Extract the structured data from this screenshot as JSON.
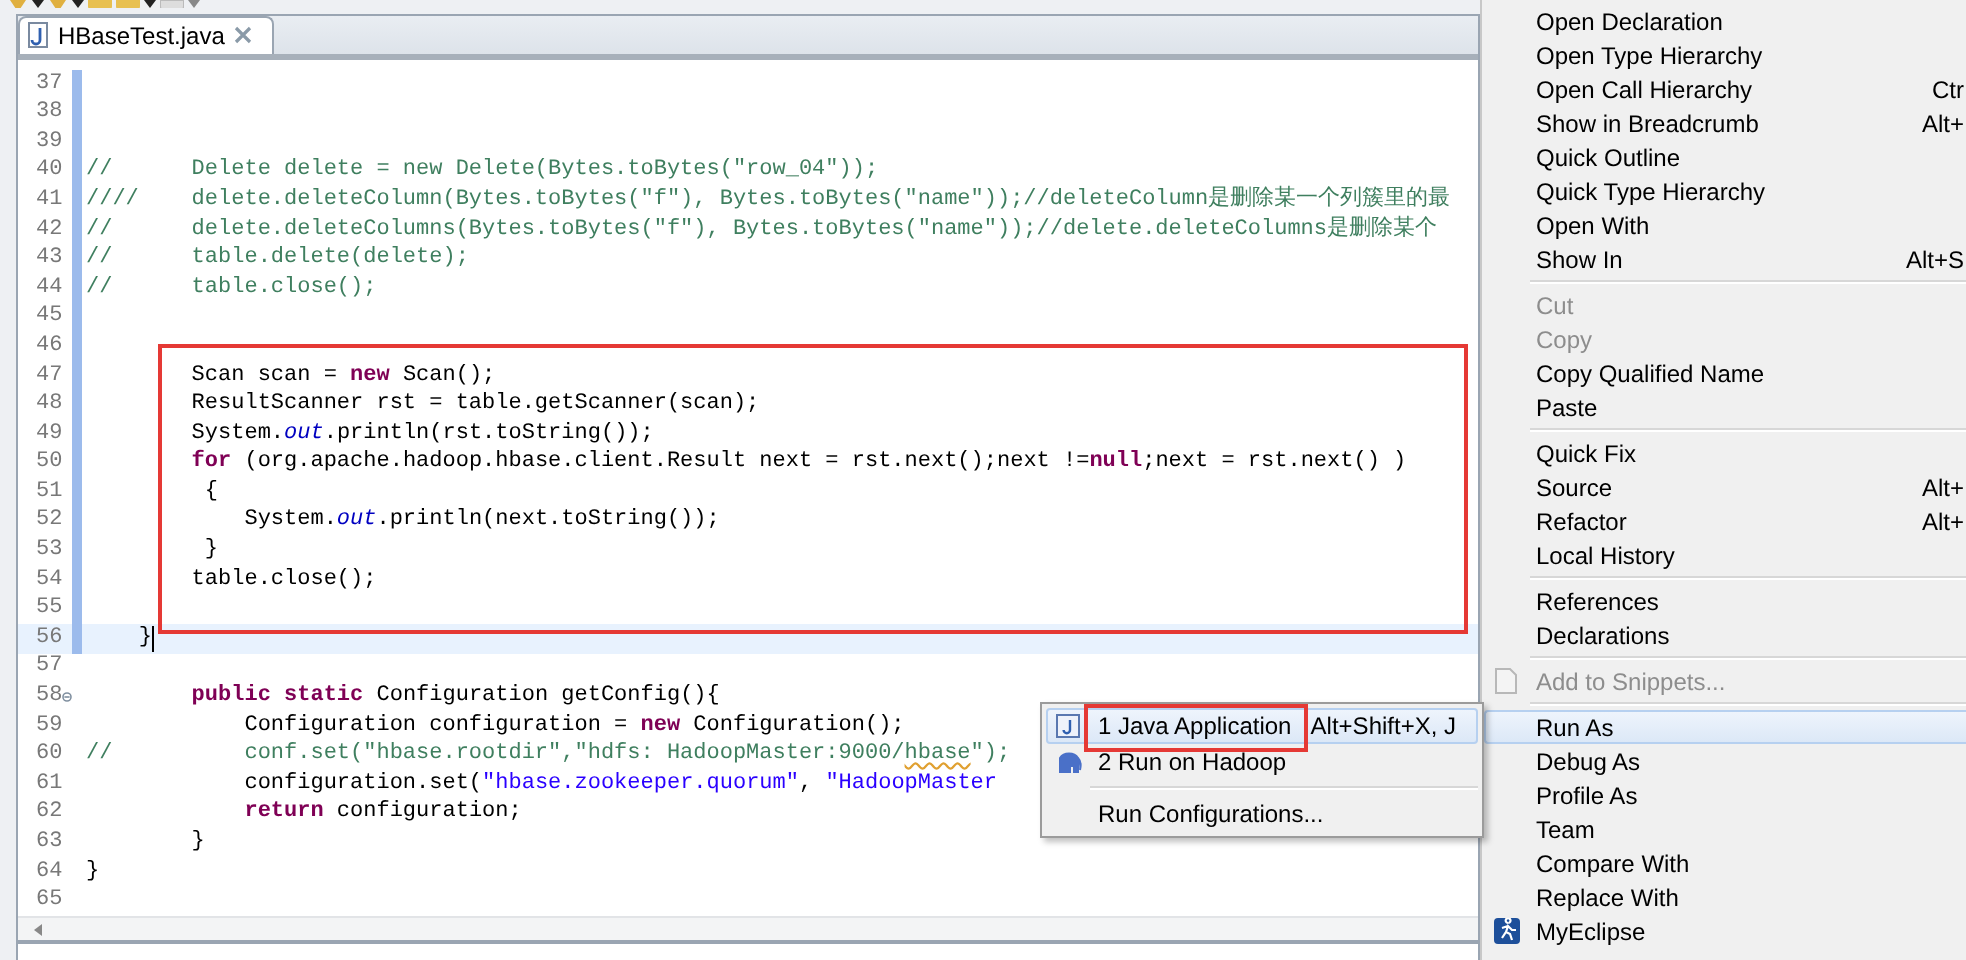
{
  "editor": {
    "tab": {
      "label": "HBaseTest.java",
      "selected": true
    },
    "lines": [
      {
        "number": "37",
        "marked": true,
        "current": false,
        "fold": false
      },
      {
        "number": "38",
        "marked": true,
        "current": false,
        "fold": false
      },
      {
        "number": "39",
        "marked": true,
        "current": false,
        "fold": false
      },
      {
        "number": "40",
        "marked": true,
        "current": false,
        "fold": false,
        "segments": [
          {
            "text": "//      Delete delete = new Delete(Bytes.toBytes(\"row_04\"));",
            "kind": "comment"
          }
        ]
      },
      {
        "number": "41",
        "marked": true,
        "current": false,
        "fold": false,
        "segments": [
          {
            "text": "////    delete.deleteColumn(Bytes.toBytes(\"f\"), Bytes.toBytes(\"name\"));//deleteColumn是删除某一个列簇里的最",
            "kind": "comment"
          }
        ]
      },
      {
        "number": "42",
        "marked": true,
        "current": false,
        "fold": false,
        "segments": [
          {
            "text": "//      delete.deleteColumns(Bytes.toBytes(\"f\"), Bytes.toBytes(\"name\"));//delete.deleteColumns是删除某个",
            "kind": "comment"
          }
        ]
      },
      {
        "number": "43",
        "marked": true,
        "current": false,
        "fold": false,
        "segments": [
          {
            "text": "//      table.delete(delete);",
            "kind": "comment"
          }
        ]
      },
      {
        "number": "44",
        "marked": true,
        "current": false,
        "fold": false,
        "segments": [
          {
            "text": "//      table.close();",
            "kind": "comment"
          }
        ]
      },
      {
        "number": "45",
        "marked": true,
        "current": false,
        "fold": false
      },
      {
        "number": "46",
        "marked": true,
        "current": false,
        "fold": false
      },
      {
        "number": "47",
        "marked": true,
        "current": false,
        "fold": false,
        "segments": [
          {
            "text": "        Scan scan = ",
            "kind": "plain"
          },
          {
            "text": "new",
            "kind": "keyword"
          },
          {
            "text": " Scan();",
            "kind": "plain"
          }
        ]
      },
      {
        "number": "48",
        "marked": true,
        "current": false,
        "fold": false,
        "segments": [
          {
            "text": "        ResultScanner rst = table.getScanner(scan);",
            "kind": "plain"
          }
        ]
      },
      {
        "number": "49",
        "marked": true,
        "current": false,
        "fold": false,
        "segments": [
          {
            "text": "        System.",
            "kind": "plain"
          },
          {
            "text": "out",
            "kind": "field"
          },
          {
            "text": ".println(rst.toString());",
            "kind": "plain"
          }
        ]
      },
      {
        "number": "50",
        "marked": true,
        "current": false,
        "fold": false,
        "segments": [
          {
            "text": "        for",
            "kind": "keyword"
          },
          {
            "text": " (org.apache.hadoop.hbase.client.Result next = rst.next();next !=",
            "kind": "plain"
          },
          {
            "text": "null",
            "kind": "keyword"
          },
          {
            "text": ";next = rst.next() )",
            "kind": "plain"
          }
        ]
      },
      {
        "number": "51",
        "marked": true,
        "current": false,
        "fold": false,
        "segments": [
          {
            "text": "         {",
            "kind": "plain"
          }
        ]
      },
      {
        "number": "52",
        "marked": true,
        "current": false,
        "fold": false,
        "segments": [
          {
            "text": "            System.",
            "kind": "plain"
          },
          {
            "text": "out",
            "kind": "field"
          },
          {
            "text": ".println(next.toString());",
            "kind": "plain"
          }
        ]
      },
      {
        "number": "53",
        "marked": true,
        "current": false,
        "fold": false,
        "segments": [
          {
            "text": "         }",
            "kind": "plain"
          }
        ]
      },
      {
        "number": "54",
        "marked": true,
        "current": false,
        "fold": false,
        "segments": [
          {
            "text": "        table.close();",
            "kind": "plain"
          }
        ]
      },
      {
        "number": "55",
        "marked": true,
        "current": false,
        "fold": false
      },
      {
        "number": "56",
        "marked": true,
        "current": true,
        "fold": false,
        "segments": [
          {
            "text": "    }",
            "kind": "plain"
          }
        ]
      },
      {
        "number": "57",
        "marked": false,
        "current": false,
        "fold": false
      },
      {
        "number": "58",
        "marked": false,
        "current": false,
        "fold": true,
        "segments": [
          {
            "text": "        public",
            "kind": "keyword"
          },
          {
            "text": " static",
            "kind": "keyword"
          },
          {
            "text": " Configuration getConfig(){",
            "kind": "plain"
          }
        ]
      },
      {
        "number": "59",
        "marked": false,
        "current": false,
        "fold": false,
        "segments": [
          {
            "text": "            Configuration configuration = ",
            "kind": "plain"
          },
          {
            "text": "new",
            "kind": "keyword"
          },
          {
            "text": " Configuration();",
            "kind": "plain"
          }
        ]
      },
      {
        "number": "60",
        "marked": false,
        "current": false,
        "fold": false,
        "segments": [
          {
            "text": "//          conf.set(\"hbase.rootdir\",\"hdfs: HadoopMaster:9000/",
            "kind": "comment"
          },
          {
            "text": "hbase",
            "kind": "misspelled"
          },
          {
            "text": "\");",
            "kind": "comment"
          }
        ]
      },
      {
        "number": "61",
        "marked": false,
        "current": false,
        "fold": false,
        "segments": [
          {
            "text": "            configuration.set(",
            "kind": "plain"
          },
          {
            "text": "\"hbase.zookeeper.quorum\"",
            "kind": "string"
          },
          {
            "text": ", ",
            "kind": "plain"
          },
          {
            "text": "\"HadoopMaster",
            "kind": "string"
          }
        ]
      },
      {
        "number": "62",
        "marked": false,
        "current": false,
        "fold": false,
        "segments": [
          {
            "text": "            return",
            "kind": "keyword"
          },
          {
            "text": " configuration;",
            "kind": "plain"
          }
        ]
      },
      {
        "number": "63",
        "marked": false,
        "current": false,
        "fold": false,
        "segments": [
          {
            "text": "        }",
            "kind": "plain"
          }
        ]
      },
      {
        "number": "64",
        "marked": false,
        "current": false,
        "fold": false,
        "segments": [
          {
            "text": "}",
            "kind": "plain"
          }
        ]
      },
      {
        "number": "65",
        "marked": false,
        "current": false,
        "fold": false
      }
    ]
  },
  "submenu": {
    "groups": [
      {
        "items": [
          {
            "label": "1 Java Application",
            "shortcut": "Alt+Shift+X, J",
            "kind": "java",
            "selected": true,
            "outlined": true
          },
          {
            "label": "2 Run on Hadoop",
            "kind": "elephant",
            "selected": false,
            "outlined": false
          }
        ]
      },
      {
        "items": [
          {
            "label": "Run Configurations...",
            "kind": "plain",
            "selected": false,
            "outlined": false
          }
        ]
      }
    ]
  },
  "context_menu": {
    "groups": [
      {
        "items": [
          {
            "label": "Open Declaration",
            "kind": "plain",
            "disabled": false,
            "selected": false
          },
          {
            "label": "Open Type Hierarchy",
            "kind": "plain",
            "disabled": false,
            "selected": false
          },
          {
            "label": "Open Call Hierarchy",
            "shortcut": "Ctr",
            "kind": "plain",
            "disabled": false,
            "selected": false
          },
          {
            "label": "Show in Breadcrumb",
            "shortcut": "Alt+",
            "kind": "plain",
            "disabled": false,
            "selected": false
          },
          {
            "label": "Quick Outline",
            "kind": "plain",
            "disabled": false,
            "selected": false
          },
          {
            "label": "Quick Type Hierarchy",
            "kind": "plain",
            "disabled": false,
            "selected": false
          },
          {
            "label": "Open With",
            "kind": "plain",
            "disabled": false,
            "selected": false
          },
          {
            "label": "Show In",
            "shortcut": "Alt+S",
            "kind": "plain",
            "disabled": false,
            "selected": false
          }
        ]
      },
      {
        "items": [
          {
            "label": "Cut",
            "kind": "plain",
            "disabled": true,
            "selected": false
          },
          {
            "label": "Copy",
            "kind": "plain",
            "disabled": true,
            "selected": false
          },
          {
            "label": "Copy Qualified Name",
            "kind": "plain",
            "disabled": false,
            "selected": false
          },
          {
            "label": "Paste",
            "kind": "plain",
            "disabled": false,
            "selected": false
          }
        ]
      },
      {
        "items": [
          {
            "label": "Quick Fix",
            "kind": "plain",
            "disabled": false,
            "selected": false
          },
          {
            "label": "Source",
            "shortcut": "Alt+",
            "kind": "plain",
            "disabled": false,
            "selected": false
          },
          {
            "label": "Refactor",
            "shortcut": "Alt+",
            "kind": "plain",
            "disabled": false,
            "selected": false
          },
          {
            "label": "Local History",
            "kind": "plain",
            "disabled": false,
            "selected": false
          }
        ]
      },
      {
        "items": [
          {
            "label": "References",
            "kind": "plain",
            "disabled": false,
            "selected": false
          },
          {
            "label": "Declarations",
            "kind": "plain",
            "disabled": false,
            "selected": false
          }
        ]
      },
      {
        "items": [
          {
            "label": "Add to Snippets...",
            "kind": "snippet",
            "disabled": true,
            "selected": false
          }
        ]
      },
      {
        "items": [
          {
            "label": "Run As",
            "kind": "plain",
            "disabled": false,
            "selected": true
          },
          {
            "label": "Debug As",
            "kind": "plain",
            "disabled": false,
            "selected": false
          },
          {
            "label": "Profile As",
            "kind": "plain",
            "disabled": false,
            "selected": false
          },
          {
            "label": "Team",
            "kind": "plain",
            "disabled": false,
            "selected": false
          },
          {
            "label": "Compare With",
            "kind": "plain",
            "disabled": false,
            "selected": false
          },
          {
            "label": "Replace With",
            "kind": "plain",
            "disabled": false,
            "selected": false
          },
          {
            "label": "MyEclipse",
            "kind": "runner",
            "disabled": false,
            "selected": false
          }
        ]
      }
    ]
  }
}
